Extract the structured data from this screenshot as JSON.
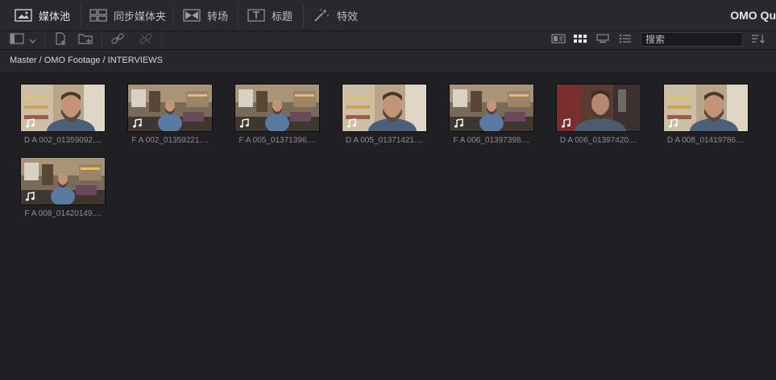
{
  "topbar": {
    "tabs": [
      {
        "label": "媒体池",
        "icon": "media-pool-icon",
        "active": true
      },
      {
        "label": "同步媒体夹",
        "icon": "sync-bin-icon",
        "active": false
      },
      {
        "label": "转场",
        "icon": "transitions-icon",
        "active": false
      },
      {
        "label": "标题",
        "icon": "titles-icon",
        "active": false
      },
      {
        "label": "特效",
        "icon": "effects-icon",
        "active": false
      }
    ],
    "project_title": "OMO Qu"
  },
  "toolbar": {
    "search_placeholder": "搜索",
    "view_mode": "thumbnail"
  },
  "breadcrumb": "Master / OMO Footage / INTERVIEWS",
  "clips": [
    {
      "name": "D A 002_01359092....",
      "shot": "closeup"
    },
    {
      "name": "F A 002_01359221....",
      "shot": "wide"
    },
    {
      "name": "F A 005_01371396....",
      "shot": "wide"
    },
    {
      "name": "D A 005_01371421....",
      "shot": "closeup"
    },
    {
      "name": "F A 006_01397398....",
      "shot": "wide"
    },
    {
      "name": "D A 006_01397420....",
      "shot": "dark"
    },
    {
      "name": "D A 008_01419786....",
      "shot": "closeup"
    },
    {
      "name": "F A 008_01420149....",
      "shot": "wide"
    }
  ],
  "colors": {
    "background": "#1f1f24",
    "panel": "#28282e",
    "text": "#c8c8c8"
  }
}
